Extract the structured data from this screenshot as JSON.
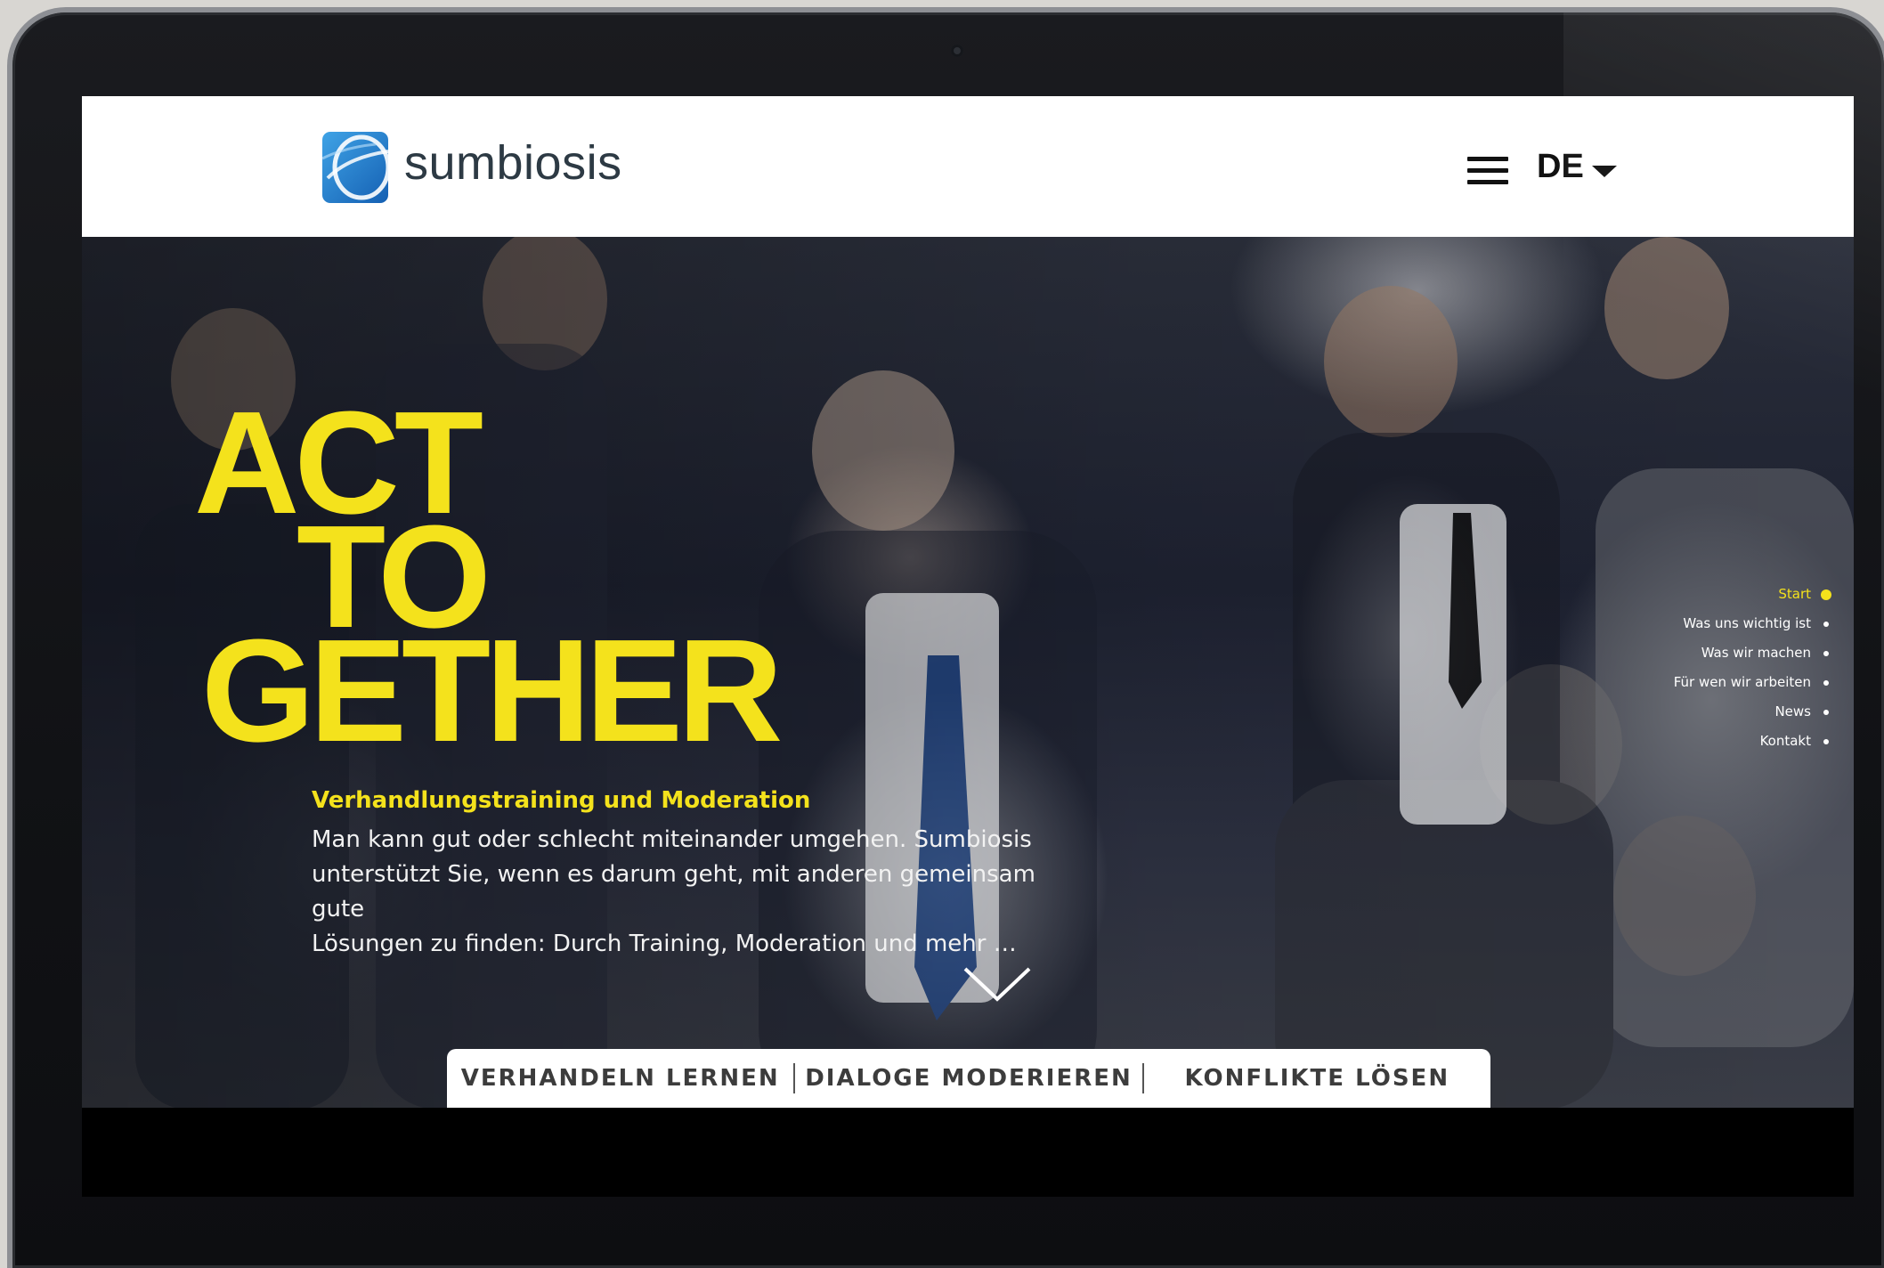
{
  "brand": {
    "name": "sumbiosis"
  },
  "header": {
    "language": "DE"
  },
  "hero": {
    "headline": [
      "ACT",
      "TO",
      "GETHER"
    ],
    "subhead": "Verhandlungstraining und Moderation",
    "body_lines": [
      "Man kann gut oder schlecht miteinander umgehen. Sumbiosis",
      "unterstützt Sie, wenn es darum geht, mit anderen gemeinsam gute",
      "Lösungen zu finden: Durch Training, Moderation und mehr …"
    ]
  },
  "dotnav": {
    "items": [
      "Start",
      "Was uns wichtig ist",
      "Was wir machen",
      "Für wen wir arbeiten",
      "News",
      "Kontakt"
    ],
    "active_index": 0
  },
  "tabs": [
    "VERHANDELN LERNEN",
    "DIALOGE MODERIEREN",
    "KONFLIKTE LÖSEN"
  ],
  "icons": {
    "logo": "sumbiosis-logo-icon",
    "menu": "hamburger-menu-icon",
    "language": "caret-down-icon",
    "scroll": "chevron-down-icon"
  },
  "colors": {
    "accent": "#f4e21c",
    "logo_blue": "#1f7cc9",
    "text_dark": "#2d3a44"
  }
}
